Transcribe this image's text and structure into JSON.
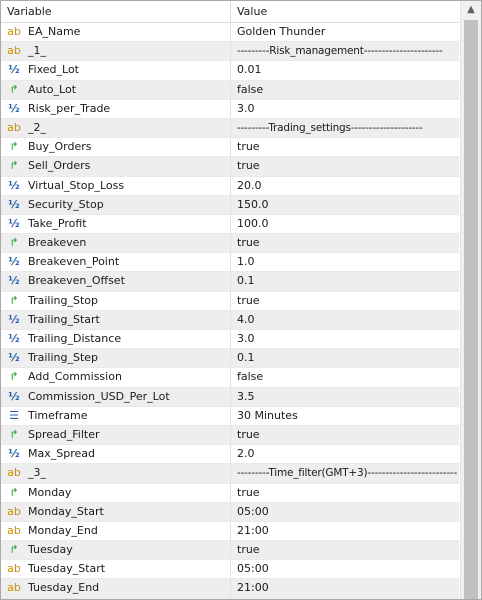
{
  "header": {
    "variable": "Variable",
    "value": "Value"
  },
  "rows": [
    {
      "type": "ab",
      "name": "EA_Name",
      "value": "Golden Thunder"
    },
    {
      "type": "ab",
      "name": "_1_",
      "value": "---------Risk_management----------------------",
      "sep": true
    },
    {
      "type": "num",
      "name": "Fixed_Lot",
      "value": "0.01"
    },
    {
      "type": "bool",
      "name": "Auto_Lot",
      "value": "false"
    },
    {
      "type": "num",
      "name": "Risk_per_Trade",
      "value": "3.0"
    },
    {
      "type": "ab",
      "name": "_2_",
      "value": "---------Trading_settings--------------------",
      "sep": true
    },
    {
      "type": "bool",
      "name": "Buy_Orders",
      "value": "true"
    },
    {
      "type": "bool",
      "name": "Sell_Orders",
      "value": "true"
    },
    {
      "type": "num",
      "name": "Virtual_Stop_Loss",
      "value": "20.0"
    },
    {
      "type": "num",
      "name": "Security_Stop",
      "value": "150.0"
    },
    {
      "type": "num",
      "name": "Take_Profit",
      "value": "100.0"
    },
    {
      "type": "bool",
      "name": "Breakeven",
      "value": "true"
    },
    {
      "type": "num",
      "name": "Breakeven_Point",
      "value": "1.0"
    },
    {
      "type": "num",
      "name": "Breakeven_Offset",
      "value": "0.1"
    },
    {
      "type": "bool",
      "name": "Trailing_Stop",
      "value": "true"
    },
    {
      "type": "num",
      "name": "Trailing_Start",
      "value": "4.0"
    },
    {
      "type": "num",
      "name": "Trailing_Distance",
      "value": "3.0"
    },
    {
      "type": "num",
      "name": "Trailing_Step",
      "value": "0.1"
    },
    {
      "type": "bool",
      "name": "Add_Commission",
      "value": "false"
    },
    {
      "type": "num",
      "name": "Commission_USD_Per_Lot",
      "value": "3.5"
    },
    {
      "type": "enum",
      "name": "Timeframe",
      "value": "30 Minutes"
    },
    {
      "type": "bool",
      "name": "Spread_Filter",
      "value": "true"
    },
    {
      "type": "num",
      "name": "Max_Spread",
      "value": "2.0"
    },
    {
      "type": "ab",
      "name": "_3_",
      "value": "---------Time_filter(GMT+3)-------------------------",
      "sep": true
    },
    {
      "type": "bool",
      "name": "Monday",
      "value": "true"
    },
    {
      "type": "ab",
      "name": "Monday_Start",
      "value": "05:00"
    },
    {
      "type": "ab",
      "name": "Monday_End",
      "value": "21:00"
    },
    {
      "type": "bool",
      "name": "Tuesday",
      "value": "true"
    },
    {
      "type": "ab",
      "name": "Tuesday_Start",
      "value": "05:00"
    },
    {
      "type": "ab",
      "name": "Tuesday_End",
      "value": "21:00"
    }
  ],
  "icons": {
    "ab": {
      "name": "string-type-icon",
      "glyph": "ab"
    },
    "num": {
      "name": "double-type-icon",
      "glyph": "½"
    },
    "bool": {
      "name": "bool-type-icon",
      "glyph": "↱"
    },
    "enum": {
      "name": "enum-type-icon",
      "glyph": "☰"
    }
  },
  "colors": {
    "alt_row": "#eeeeee",
    "string_icon": "#c79200",
    "double_icon": "#2b5ea8",
    "bool_icon": "#2f9b3c"
  }
}
